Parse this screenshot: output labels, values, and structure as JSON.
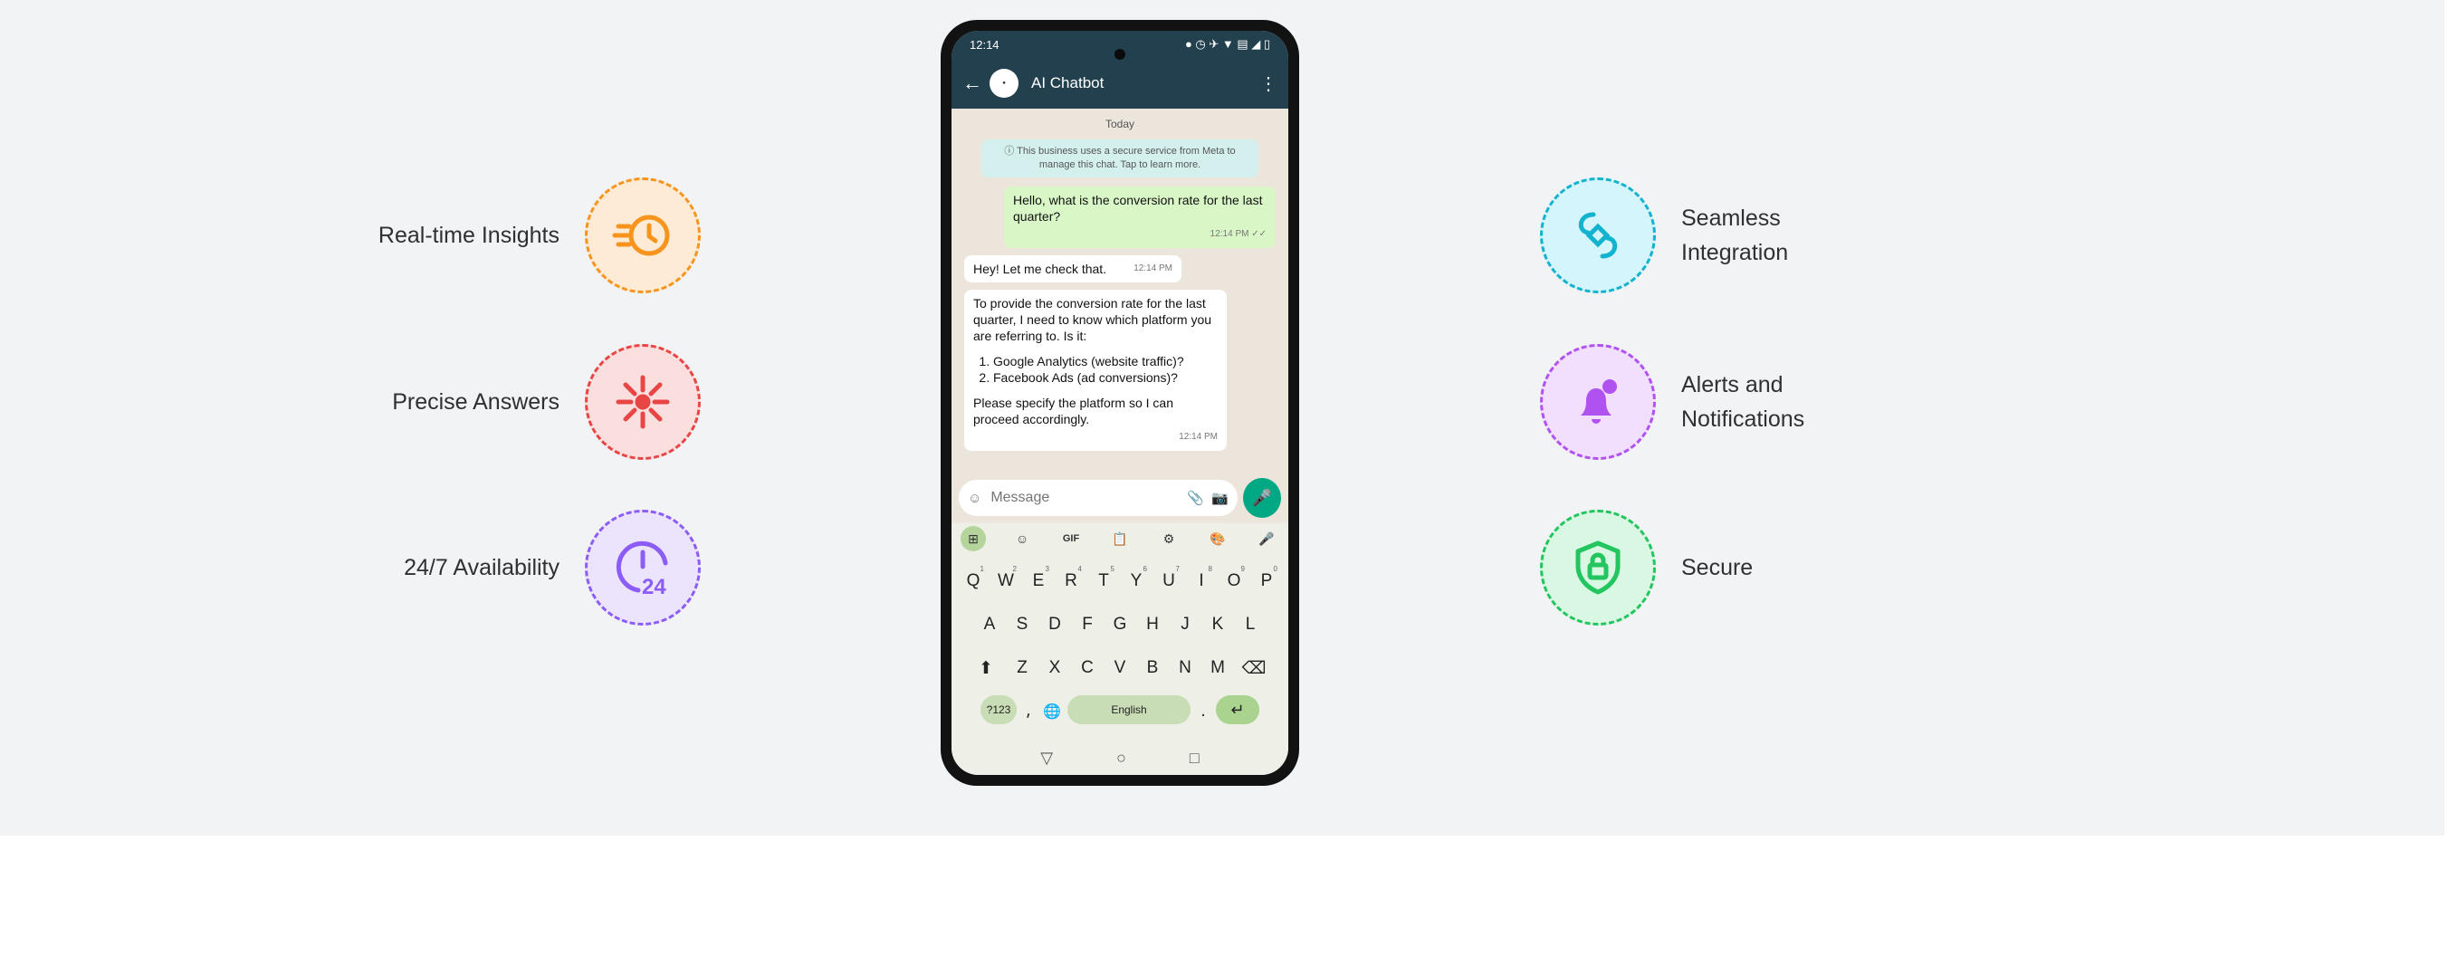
{
  "features_left": [
    {
      "label": "Real-time Insights",
      "icon": "clock-speed-icon",
      "color": "#f7941d",
      "bg": "#fdebd6"
    },
    {
      "label": "Precise Answers",
      "icon": "target-burst-icon",
      "color": "#e84545",
      "bg": "#fbdede"
    },
    {
      "label": "24/7 Availability",
      "icon": "clock-24-icon",
      "color": "#8b5cf6",
      "bg": "#ece4fd"
    }
  ],
  "features_right": [
    {
      "label_line1": "Seamless",
      "label_line2": "Integration",
      "icon": "integration-link-icon",
      "color": "#12b3cf",
      "bg": "#d4f5fb"
    },
    {
      "label_line1": "Alerts and",
      "label_line2": "Notifications",
      "icon": "bell-alert-icon",
      "color": "#b052f0",
      "bg": "#f1dffd"
    },
    {
      "label_line1": "Secure",
      "label_line2": "",
      "icon": "shield-lock-icon",
      "color": "#22c55e",
      "bg": "#d9f8e3"
    }
  ],
  "phone": {
    "status": {
      "time": "12:14",
      "indicators": "● ◷ ✈ ▼ ▤ ◢ ▯"
    },
    "appbar": {
      "title": "AI Chatbot",
      "back_icon": "arrow-left-icon",
      "more_icon": "more-vertical-icon"
    },
    "chat": {
      "day": "Today",
      "notice": "ⓘ This business uses a secure service from Meta to manage this chat. Tap to learn more.",
      "outgoing": {
        "text": "Hello, what is the conversion rate for the last quarter?",
        "time": "12:14 PM ✓✓"
      },
      "incoming_short": {
        "text": "Hey! Let me check that.",
        "time": "12:14 PM"
      },
      "incoming_long": {
        "intro": "To provide the conversion rate for the last quarter, I need to know which platform you are referring to. Is it:",
        "items": [
          "Google Analytics (website traffic)?",
          "Facebook Ads (ad conversions)?"
        ],
        "outro": "Please specify the platform so I can proceed accordingly.",
        "time": "12:14 PM"
      }
    },
    "composer": {
      "placeholder": "Message"
    },
    "keyboard": {
      "toolbar": [
        "⊞",
        "☺",
        "GIF",
        "📋",
        "⚙",
        "🎨",
        "🎤"
      ],
      "row1": [
        [
          "Q",
          "1"
        ],
        [
          "W",
          "2"
        ],
        [
          "E",
          "3"
        ],
        [
          "R",
          "4"
        ],
        [
          "T",
          "5"
        ],
        [
          "Y",
          "6"
        ],
        [
          "U",
          "7"
        ],
        [
          "I",
          "8"
        ],
        [
          "O",
          "9"
        ],
        [
          "P",
          "0"
        ]
      ],
      "row2": [
        "A",
        "S",
        "D",
        "F",
        "G",
        "H",
        "J",
        "K",
        "L"
      ],
      "row3": [
        "Z",
        "X",
        "C",
        "V",
        "B",
        "N",
        "M"
      ],
      "symbols_key": "?123",
      "space_label": "English",
      "period": ".",
      "comma": "⸴"
    }
  }
}
